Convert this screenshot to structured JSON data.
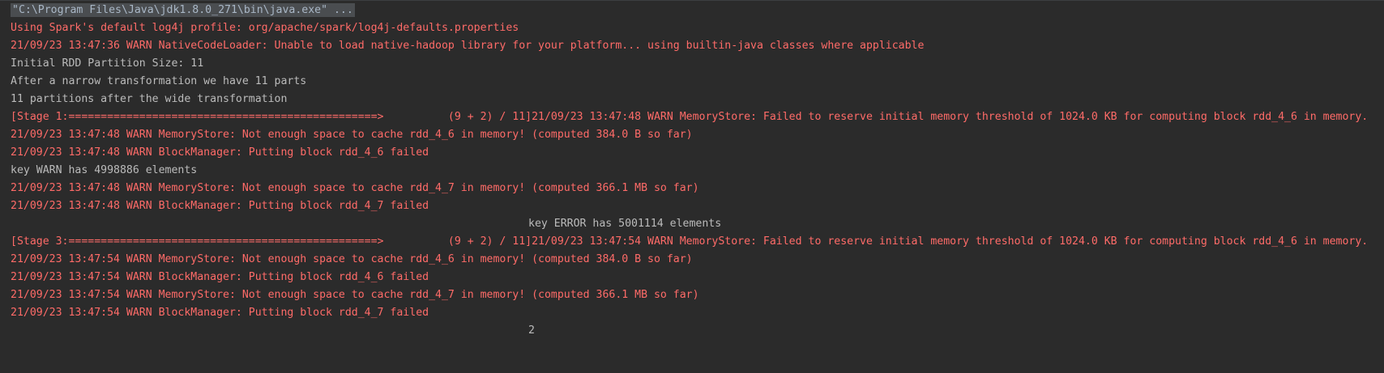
{
  "console": {
    "command": "\"C:\\Program Files\\Java\\jdk1.8.0_271\\bin\\java.exe\" ...",
    "lines": [
      {
        "text": "Using Spark's default log4j profile: org/apache/spark/log4j-defaults.properties",
        "kind": "err",
        "indent": false
      },
      {
        "text": "21/09/23 13:47:36 WARN NativeCodeLoader: Unable to load native-hadoop library for your platform... using builtin-java classes where applicable",
        "kind": "err",
        "indent": false
      },
      {
        "text": "Initial RDD Partition Size: 11",
        "kind": "out",
        "indent": false
      },
      {
        "text": "After a narrow transformation we have 11 parts",
        "kind": "out",
        "indent": false
      },
      {
        "text": "11 partitions after the wide transformation",
        "kind": "out",
        "indent": false
      },
      {
        "text": "[Stage 1:================================================>          (9 + 2) / 11]21/09/23 13:47:48 WARN MemoryStore: Failed to reserve initial memory threshold of 1024.0 KB for computing block rdd_4_6 in memory.",
        "kind": "err",
        "indent": false
      },
      {
        "text": "21/09/23 13:47:48 WARN MemoryStore: Not enough space to cache rdd_4_6 in memory! (computed 384.0 B so far)",
        "kind": "err",
        "indent": false
      },
      {
        "text": "21/09/23 13:47:48 WARN BlockManager: Putting block rdd_4_6 failed",
        "kind": "err",
        "indent": false
      },
      {
        "text": "key WARN has 4998886 elements",
        "kind": "out",
        "indent": false
      },
      {
        "text": "21/09/23 13:47:48 WARN MemoryStore: Not enough space to cache rdd_4_7 in memory! (computed 366.1 MB so far)",
        "kind": "err",
        "indent": false
      },
      {
        "text": "21/09/23 13:47:48 WARN BlockManager: Putting block rdd_4_7 failed",
        "kind": "err",
        "indent": false
      },
      {
        "text": "key ERROR has 5001114 elements",
        "kind": "out",
        "indent": true
      },
      {
        "text": "[Stage 3:================================================>          (9 + 2) / 11]21/09/23 13:47:54 WARN MemoryStore: Failed to reserve initial memory threshold of 1024.0 KB for computing block rdd_4_6 in memory.",
        "kind": "err",
        "indent": false
      },
      {
        "text": "21/09/23 13:47:54 WARN MemoryStore: Not enough space to cache rdd_4_6 in memory! (computed 384.0 B so far)",
        "kind": "err",
        "indent": false
      },
      {
        "text": "21/09/23 13:47:54 WARN BlockManager: Putting block rdd_4_6 failed",
        "kind": "err",
        "indent": false
      },
      {
        "text": "21/09/23 13:47:54 WARN MemoryStore: Not enough space to cache rdd_4_7 in memory! (computed 366.1 MB so far)",
        "kind": "err",
        "indent": false
      },
      {
        "text": "21/09/23 13:47:54 WARN BlockManager: Putting block rdd_4_7 failed",
        "kind": "err",
        "indent": false
      },
      {
        "text": "2",
        "kind": "out",
        "indent": true
      }
    ]
  },
  "colors": {
    "background": "#2b2b2b",
    "stderr": "#ff6b68",
    "stdout": "#bbbbbb"
  }
}
